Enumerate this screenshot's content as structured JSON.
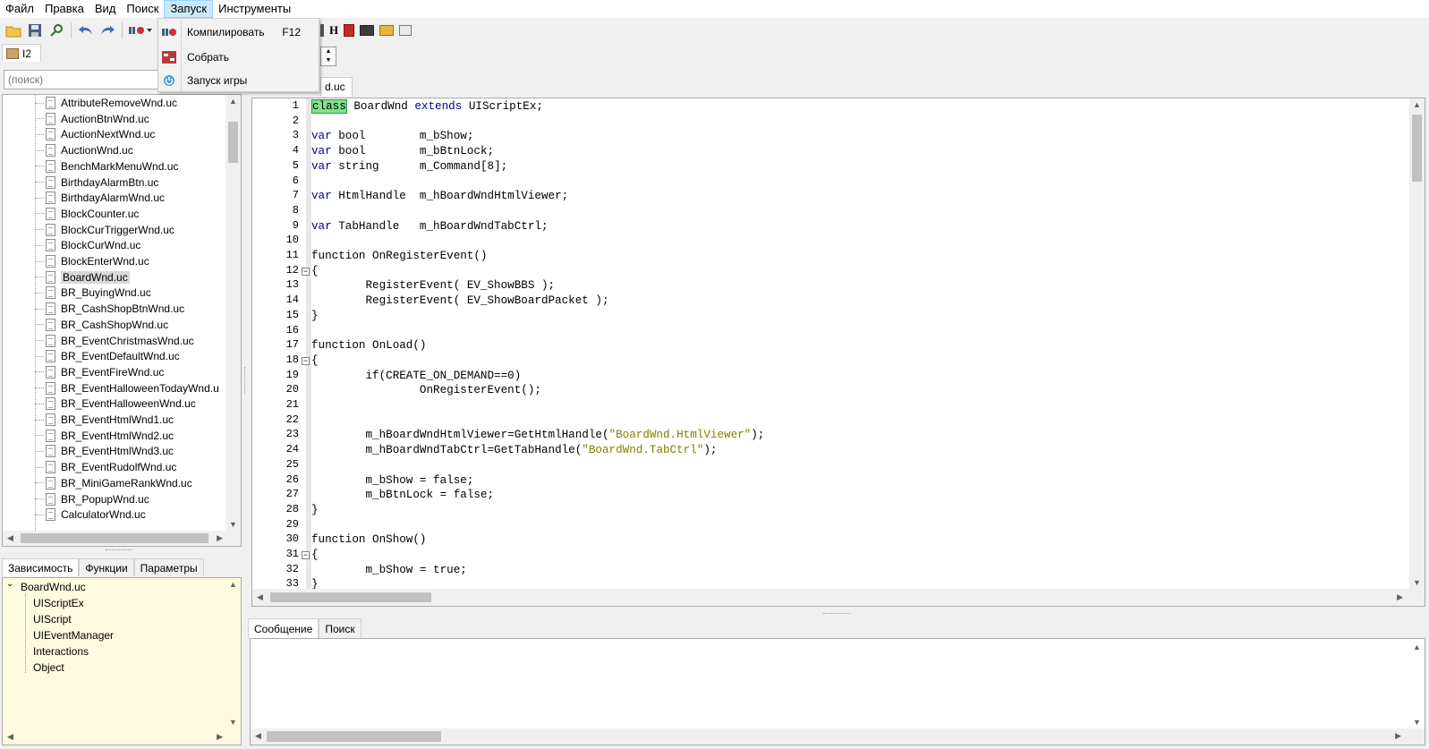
{
  "menubar": [
    "Файл",
    "Правка",
    "Вид",
    "Поиск",
    "Запуск",
    "Инструменты"
  ],
  "menubar_active": "Запуск",
  "dropdown": {
    "items": [
      {
        "label": "Компилировать",
        "shortcut": "F12",
        "icon": "compile-icon"
      },
      {
        "label": "Собрать",
        "shortcut": "",
        "icon": "build-icon"
      },
      {
        "label": "Запуск игры",
        "shortcut": "",
        "icon": "power-icon"
      }
    ]
  },
  "project_tab": {
    "label": "I2"
  },
  "search": {
    "placeholder": "(поиск)"
  },
  "file_tree": {
    "items": [
      "AttributeRemoveWnd.uc",
      "AuctionBtnWnd.uc",
      "AuctionNextWnd.uc",
      "AuctionWnd.uc",
      "BenchMarkMenuWnd.uc",
      "BirthdayAlarmBtn.uc",
      "BirthdayAlarmWnd.uc",
      "BlockCounter.uc",
      "BlockCurTriggerWnd.uc",
      "BlockCurWnd.uc",
      "BlockEnterWnd.uc",
      "BoardWnd.uc",
      "BR_BuyingWnd.uc",
      "BR_CashShopBtnWnd.uc",
      "BR_CashShopWnd.uc",
      "BR_EventChristmasWnd.uc",
      "BR_EventDefaultWnd.uc",
      "BR_EventFireWnd.uc",
      "BR_EventHalloweenTodayWnd.u",
      "BR_EventHalloweenWnd.uc",
      "BR_EventHtmlWnd1.uc",
      "BR_EventHtmlWnd2.uc",
      "BR_EventHtmlWnd3.uc",
      "BR_EventRudolfWnd.uc",
      "BR_MiniGameRankWnd.uc",
      "BR_PopupWnd.uc",
      "CalculatorWnd.uc"
    ],
    "selected": "BoardWnd.uc"
  },
  "left_bottom_tabs": [
    "Зависимость",
    "Функции",
    "Параметры"
  ],
  "dependency_tree": {
    "root": "BoardWnd.uc",
    "children": [
      "UIScriptEx",
      "UIScript",
      "UIEventManager",
      "Interactions",
      "Object"
    ]
  },
  "editor_tab": {
    "label": "d.uc"
  },
  "code_lines": [
    "class BoardWnd extends UIScriptEx;",
    "",
    "var bool        m_bShow;",
    "var bool        m_bBtnLock;",
    "var string      m_Command[8];",
    "",
    "var HtmlHandle  m_hBoardWndHtmlViewer;",
    "",
    "var TabHandle   m_hBoardWndTabCtrl;",
    "",
    "function OnRegisterEvent()",
    "{",
    "        RegisterEvent( EV_ShowBBS );",
    "        RegisterEvent( EV_ShowBoardPacket );",
    "}",
    "",
    "function OnLoad()",
    "{",
    "        if(CREATE_ON_DEMAND==0)",
    "                OnRegisterEvent();",
    "",
    "",
    "        m_hBoardWndHtmlViewer=GetHtmlHandle(\"BoardWnd.HtmlViewer\");",
    "        m_hBoardWndTabCtrl=GetTabHandle(\"BoardWnd.TabCtrl\");",
    "",
    "        m_bShow = false;",
    "        m_bBtnLock = false;",
    "}",
    "",
    "function OnShow()",
    "{",
    "        m_bShow = true;",
    "}"
  ],
  "message_tabs": [
    "Сообщение",
    "Поиск"
  ],
  "colors": {
    "keyword": "#00008b",
    "string": "#808000",
    "highlight": "#7fe08e",
    "dep_bg": "#fefbe0"
  }
}
